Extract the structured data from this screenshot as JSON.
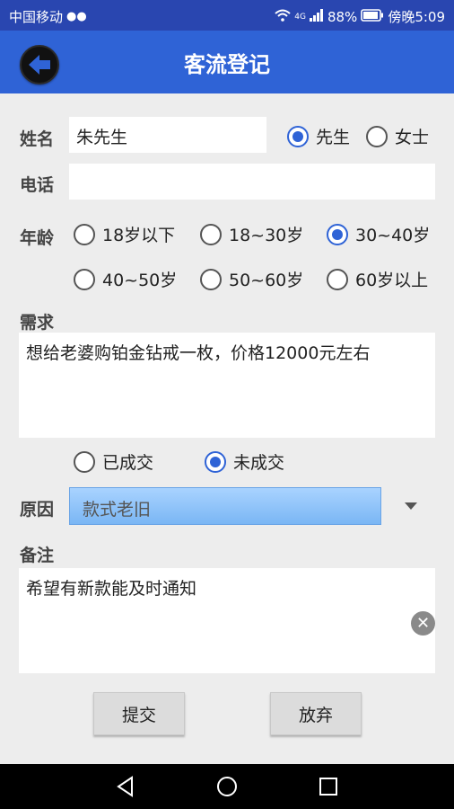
{
  "status": {
    "carrier": "中国移动",
    "battery": "88%",
    "time": "傍晚5:09",
    "network": "4G"
  },
  "app": {
    "title": "客流登记"
  },
  "form": {
    "name_label": "姓名",
    "name_value": "朱先生",
    "gender_options": [
      "先生",
      "女士"
    ],
    "gender_selected": 0,
    "phone_label": "电话",
    "phone_value": "",
    "age_label": "年龄",
    "age_options": [
      "18岁以下",
      "18~30岁",
      "30~40岁",
      "40~50岁",
      "50~60岁",
      "60岁以上"
    ],
    "age_selected": 2,
    "need_label": "需求",
    "need_value": "想给老婆购铂金钻戒一枚，价格12000元左右",
    "deal_options": [
      "已成交",
      "未成交"
    ],
    "deal_selected": 1,
    "reason_label": "原因",
    "reason_value": "款式老旧",
    "remark_label": "备注",
    "remark_value": "希望有新款能及时通知"
  },
  "buttons": {
    "submit": "提交",
    "discard": "放弃"
  }
}
